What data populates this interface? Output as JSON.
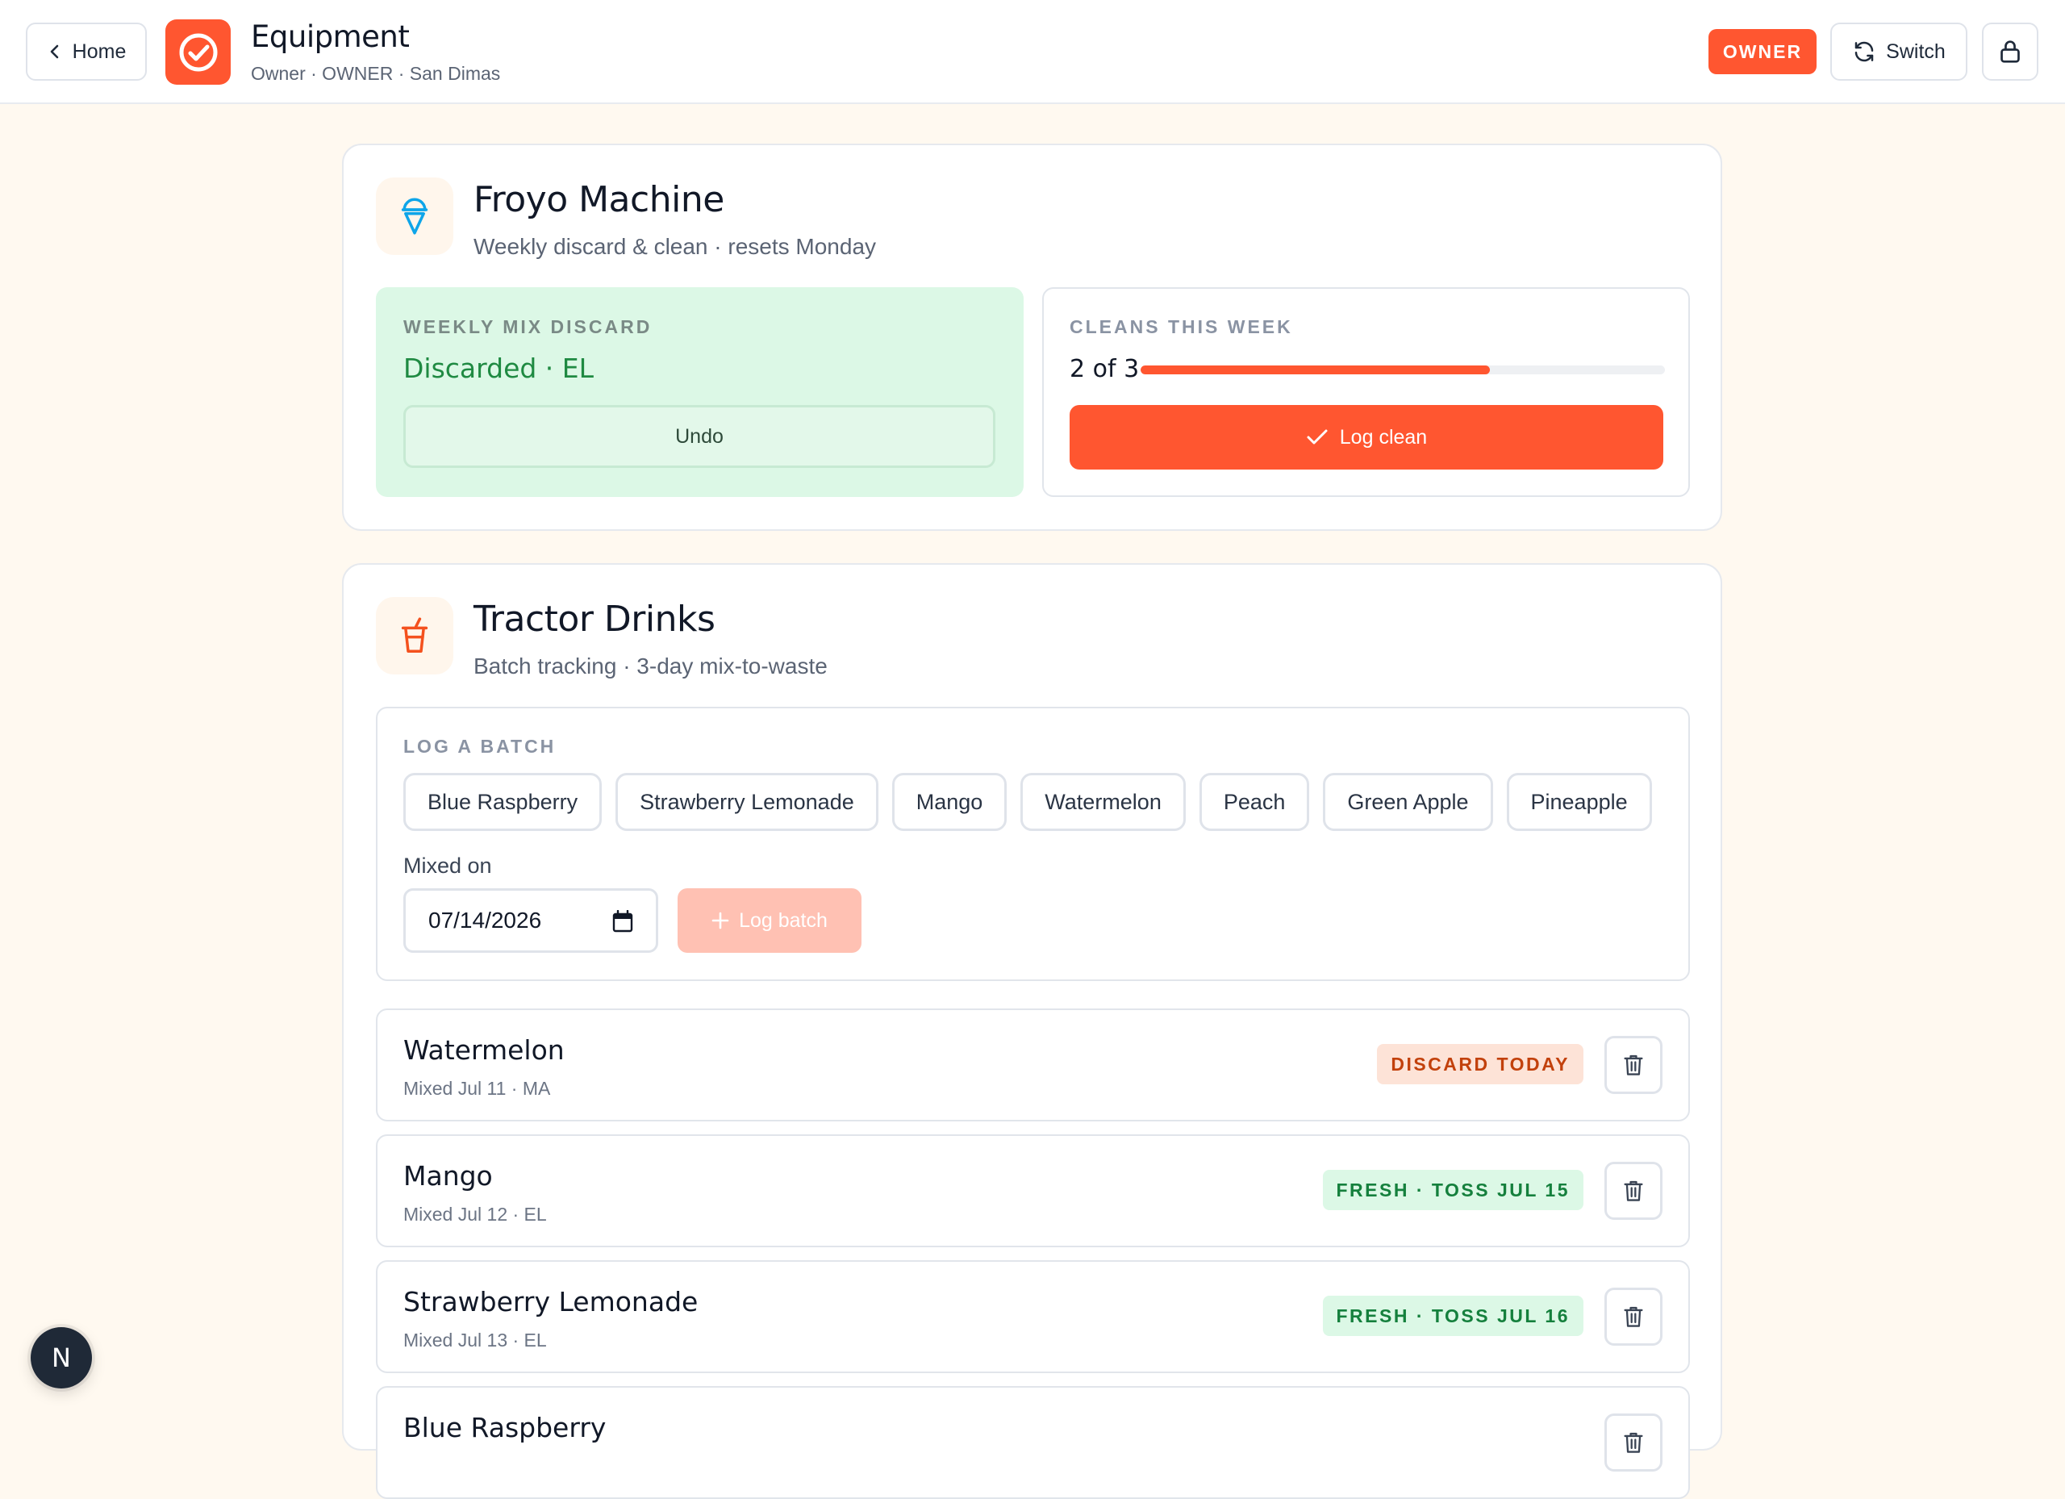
{
  "header": {
    "back_label": "Home",
    "title": "Equipment",
    "subtitle": "Owner · OWNER · San Dimas",
    "role_badge": "OWNER",
    "switch_label": "Switch",
    "accent": "#ff5630"
  },
  "froyo": {
    "title": "Froyo Machine",
    "subtitle": "Weekly discard & clean · resets Monday",
    "icon": "ice-cream-icon",
    "discard": {
      "label": "WEEKLY MIX DISCARD",
      "status": "Discarded · EL",
      "undo_label": "Undo"
    },
    "cleans": {
      "label": "CLEANS THIS WEEK",
      "count_text": "2 of 3",
      "done": 2,
      "target": 3,
      "button_label": "Log clean"
    }
  },
  "tractor": {
    "title": "Tractor Drinks",
    "subtitle": "Batch tracking · 3-day mix-to-waste",
    "icon": "drink-cup-icon",
    "log": {
      "label": "LOG A BATCH",
      "flavors": [
        "Blue Raspberry",
        "Strawberry Lemonade",
        "Mango",
        "Watermelon",
        "Peach",
        "Green Apple",
        "Pineapple"
      ],
      "mixed_on_label": "Mixed on",
      "date_value": "07/14/2026",
      "button_label": "Log batch"
    },
    "batches": [
      {
        "name": "Watermelon",
        "meta": "Mixed Jul 11 · MA",
        "status": "DISCARD TODAY",
        "kind": "discard"
      },
      {
        "name": "Mango",
        "meta": "Mixed Jul 12 · EL",
        "status": "FRESH · TOSS JUL 15",
        "kind": "fresh"
      },
      {
        "name": "Strawberry Lemonade",
        "meta": "Mixed Jul 13 · EL",
        "status": "FRESH · TOSS JUL 16",
        "kind": "fresh"
      },
      {
        "name": "Blue Raspberry",
        "meta": "",
        "status": "",
        "kind": "fresh"
      }
    ]
  },
  "dev": {
    "fab_label": "N"
  }
}
